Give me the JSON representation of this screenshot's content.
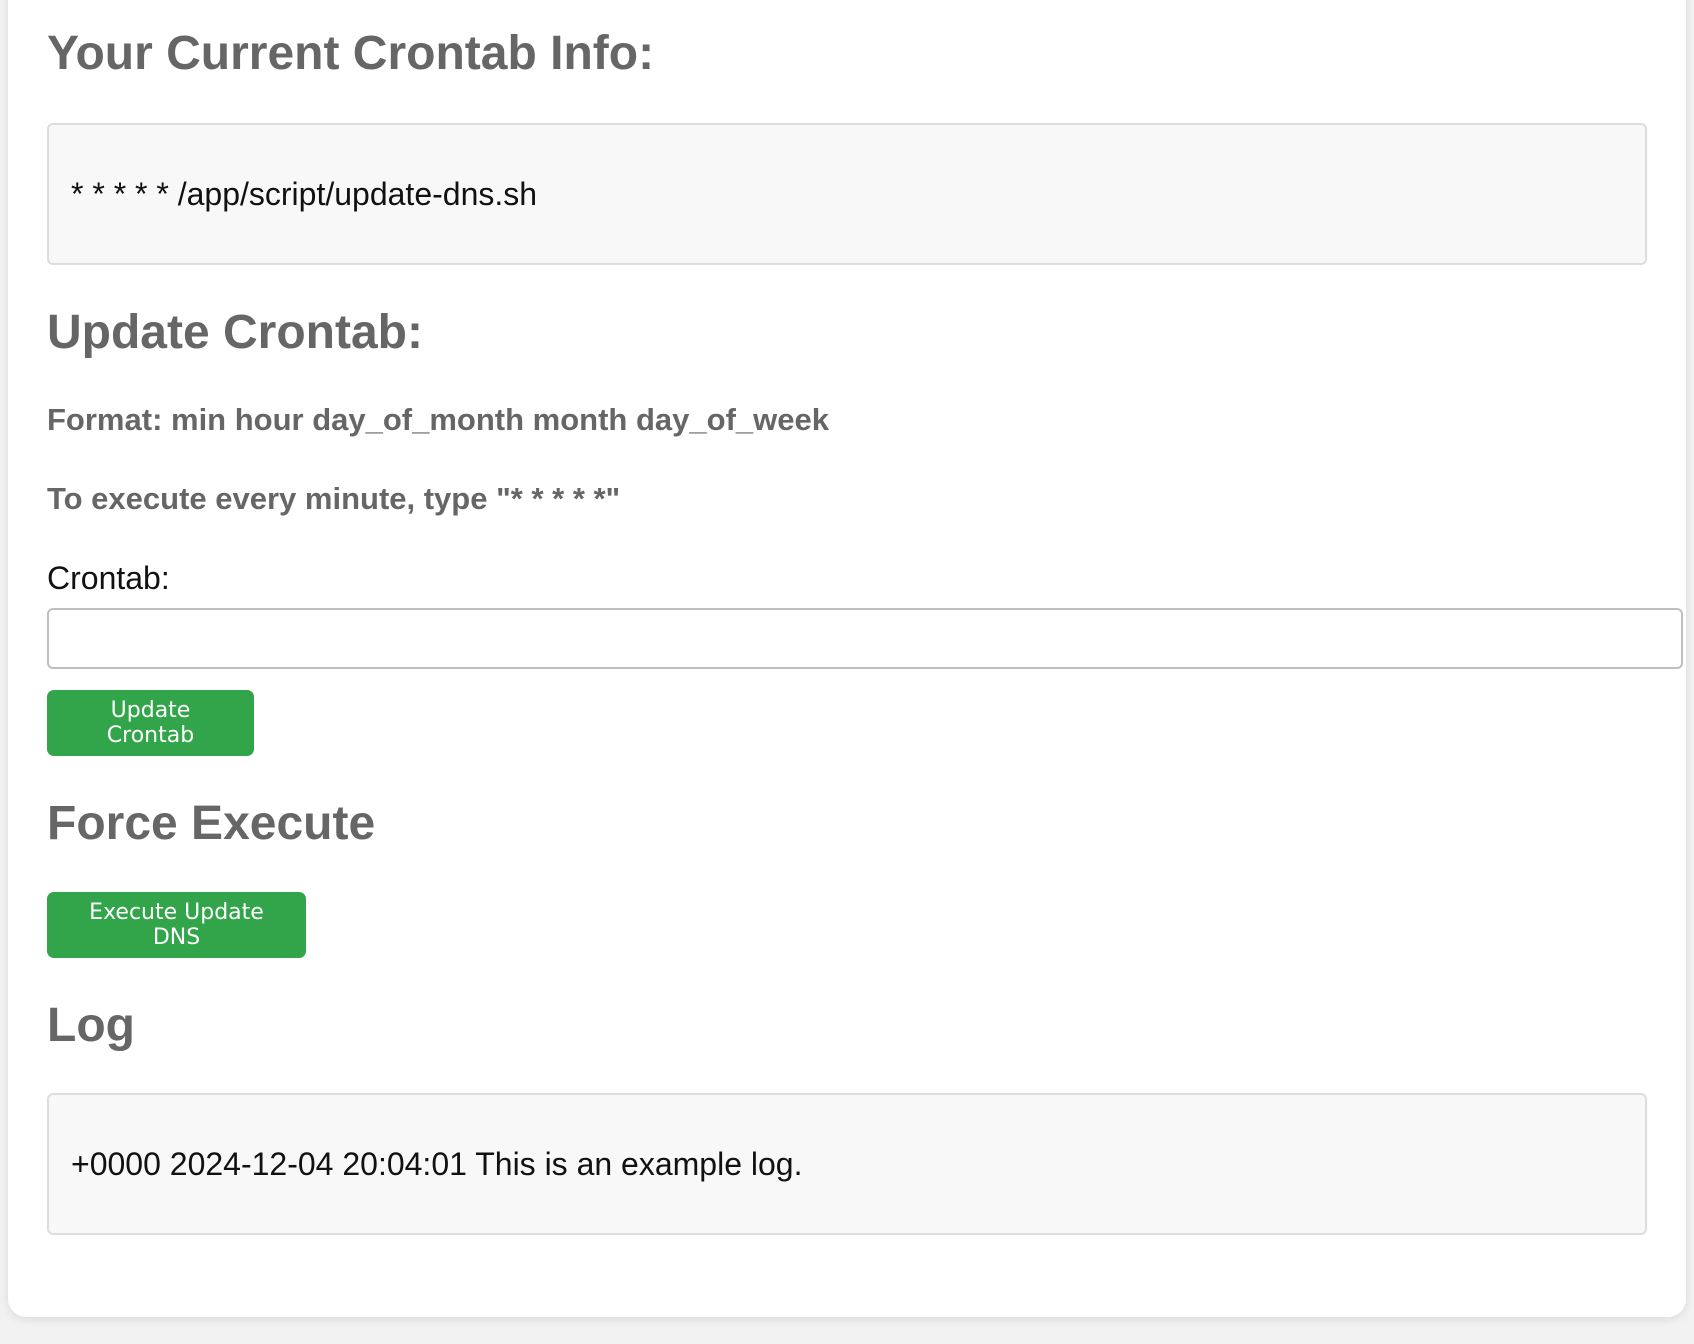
{
  "current": {
    "heading": "Your Current Crontab Info:",
    "entry": "* * * * * /app/script/update-dns.sh"
  },
  "update": {
    "heading": "Update Crontab:",
    "format_hint": "Format: min hour day_of_month month day_of_week",
    "every_minute_hint": "To execute every minute, type \"* * * * *\"",
    "label": "Crontab:",
    "input_value": "",
    "button_label": "Update Crontab"
  },
  "force": {
    "heading": "Force Execute",
    "button_label": "Execute Update DNS"
  },
  "log": {
    "heading": "Log",
    "entry": "+0000 2024-12-04 20:04:01 This is an example log."
  },
  "colors": {
    "button_green": "#32a54a",
    "heading_gray": "#666666",
    "box_background": "#f8f8f8",
    "box_border": "#dddddd"
  }
}
